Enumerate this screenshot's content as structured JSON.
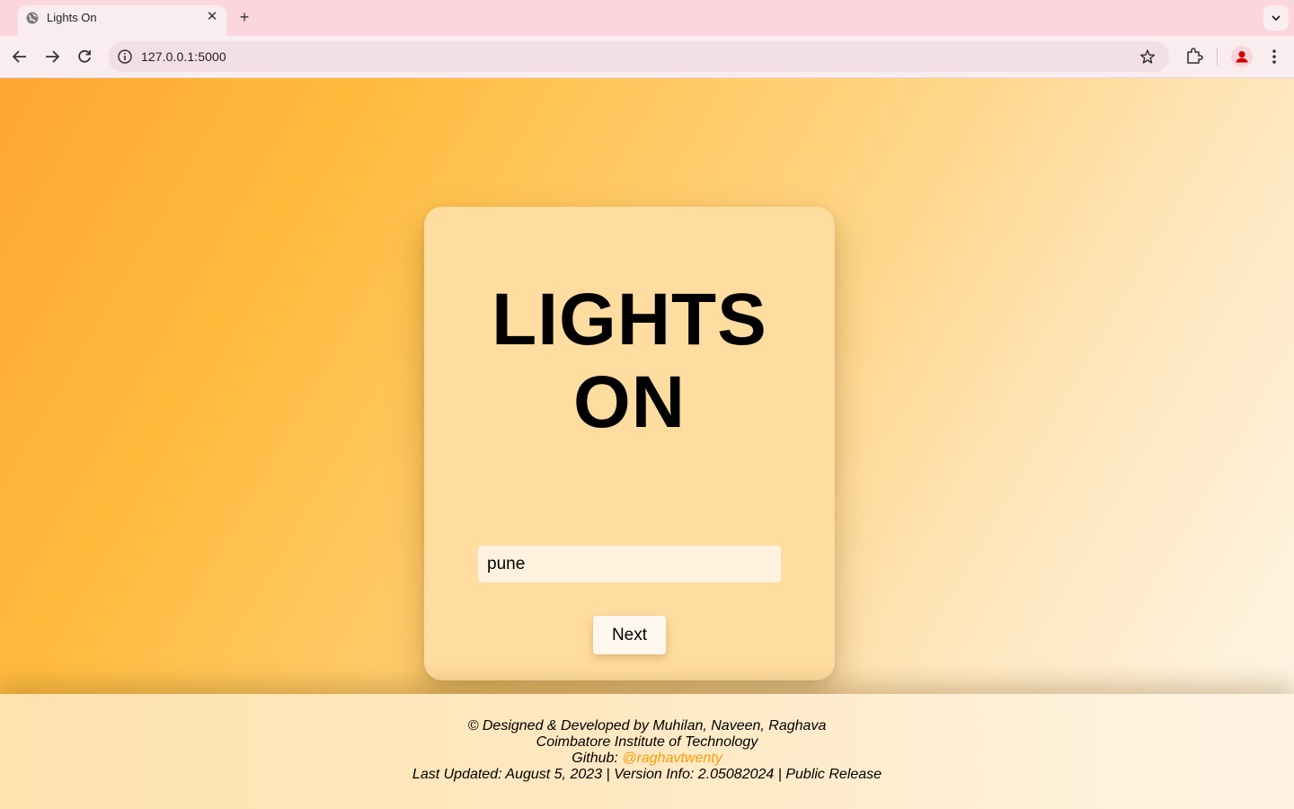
{
  "browser": {
    "tab_title": "Lights On",
    "url": "127.0.0.1:5000"
  },
  "app": {
    "title_line1": "LIGHTS",
    "title_line2": "ON",
    "city_input_value": "pune",
    "next_label": "Next"
  },
  "footer": {
    "credit": "© Designed & Developed by Muhilan, Naveen, Raghava",
    "institute": "Coimbatore Institute of Technology",
    "github_prefix": "Github: ",
    "github_handle": "@raghavtwenty",
    "release_info": "Last Updated: August 5, 2023 | Version Info: 2.05082024 | Public Release"
  },
  "colors": {
    "footer_link": "#ff9a00",
    "card_bg": "#ffdca0"
  }
}
